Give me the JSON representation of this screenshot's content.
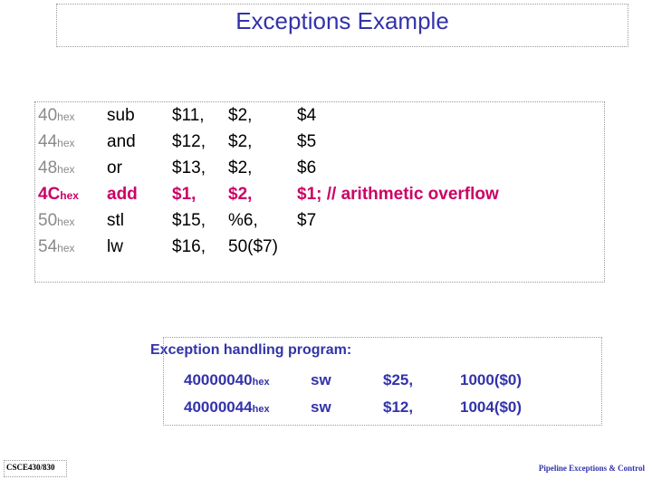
{
  "slide": {
    "title": "Exceptions Example"
  },
  "code": {
    "rows": [
      {
        "addr": "40",
        "hex": "hex",
        "op": "sub",
        "a1": "$11,",
        "a2": "$2,",
        "a3": "$4",
        "highlight": false
      },
      {
        "addr": "44",
        "hex": "hex",
        "op": "and",
        "a1": "$12,",
        "a2": "$2,",
        "a3": "$5",
        "highlight": false
      },
      {
        "addr": "48",
        "hex": "hex",
        "op": "or",
        "a1": "$13,",
        "a2": "$2,",
        "a3": "$6",
        "highlight": false
      },
      {
        "addr": "4C",
        "hex": "hex",
        "op": "add",
        "a1": "$1,",
        "a2": "$2,",
        "a3": "$1; // arithmetic overflow",
        "highlight": true
      },
      {
        "addr": "50",
        "hex": "hex",
        "op": "stl",
        "a1": "$15,",
        "a2": "%6,",
        "a3": "$7",
        "highlight": false
      },
      {
        "addr": "54",
        "hex": "hex",
        "op": "lw",
        "a1": "$16,",
        "a2": "50($7)",
        "a3": "",
        "highlight": false
      }
    ]
  },
  "handler": {
    "title": "Exception handling program:",
    "rows": [
      {
        "addr": "40000040",
        "hex": "hex",
        "op": "sw",
        "a1": "$25,",
        "a2": "1000($0)"
      },
      {
        "addr": "40000044",
        "hex": "hex",
        "op": "sw",
        "a1": "$12,",
        "a2": "1004($0)"
      }
    ]
  },
  "footer": {
    "left": "CSCE430/830",
    "right": "Pipeline Exceptions & Control"
  }
}
